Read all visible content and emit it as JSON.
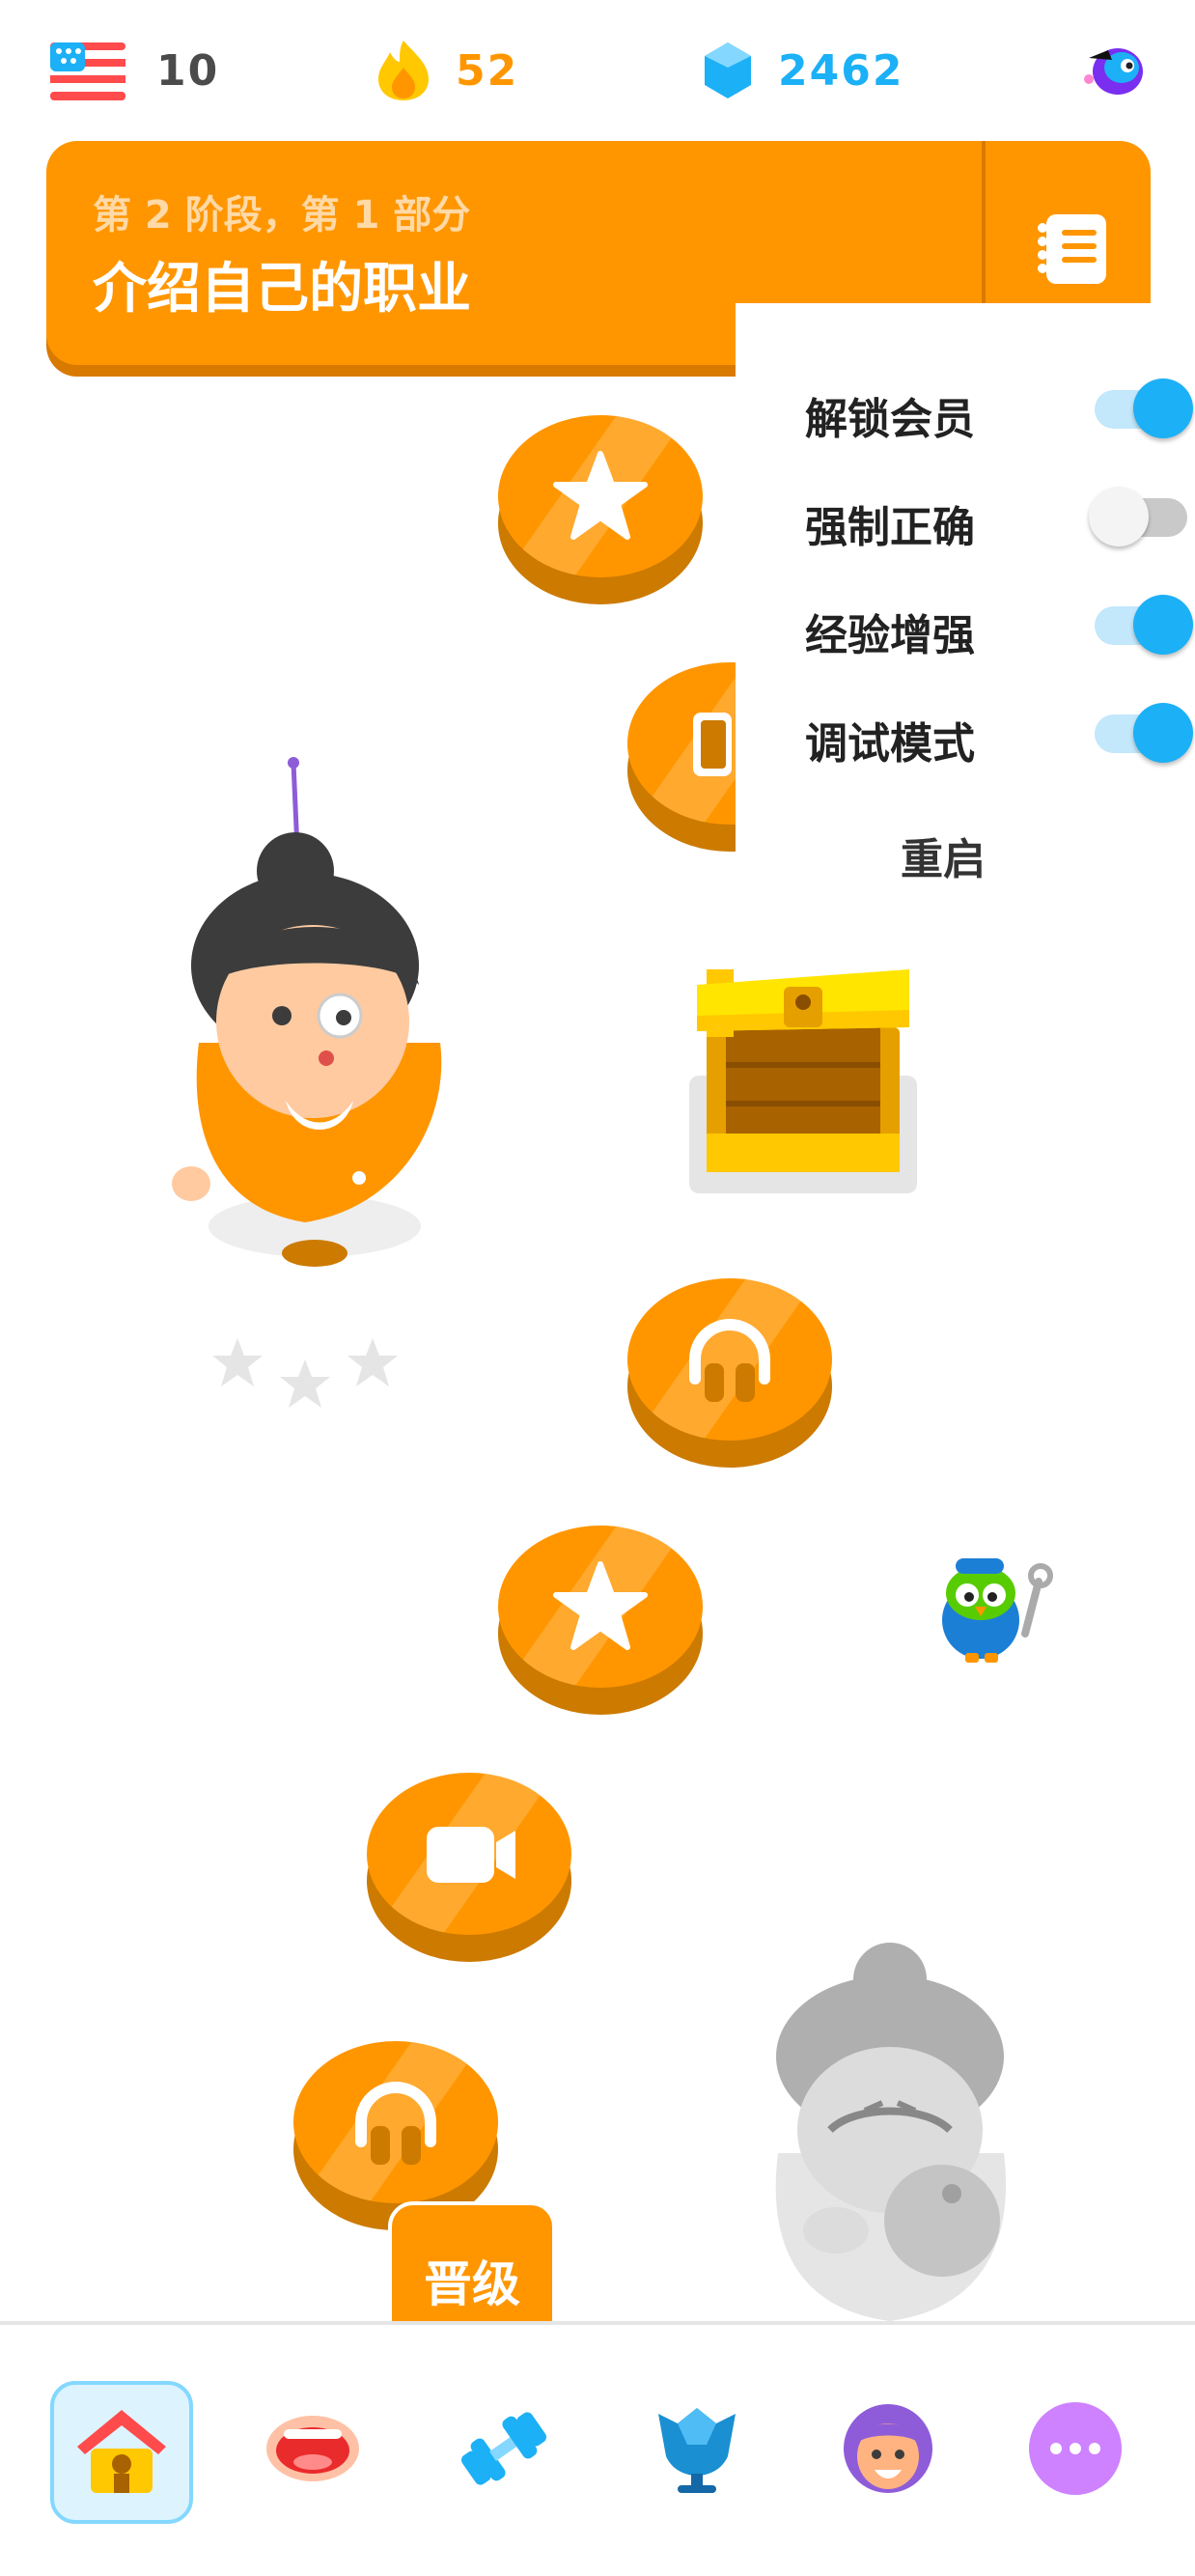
{
  "stats": {
    "course_flag": "us-flag-icon",
    "course_count": "10",
    "streak_icon": "fire-icon",
    "streak": "52",
    "gems_icon": "gem-icon",
    "gems": "2462",
    "profile_icon": "duo-avatar-icon",
    "colors": {
      "count": "#4b4b4b",
      "streak": "#ff9600",
      "gems": "#1cb0f6"
    }
  },
  "unit": {
    "subtitle": "第 2 阶段，第 1 部分",
    "title": "介绍自己的职业",
    "guide_icon": "guidebook-icon",
    "color": "#ff9600"
  },
  "debug_panel": {
    "toggles": [
      {
        "label": "解锁会员",
        "on": true
      },
      {
        "label": "强制正确",
        "on": false
      },
      {
        "label": "经验增强",
        "on": true
      },
      {
        "label": "调试模式",
        "on": true
      }
    ],
    "restart_label": "重启"
  },
  "path": {
    "nodes": [
      {
        "type": "star-icon"
      },
      {
        "type": "book-icon"
      },
      {
        "type": "treasure-chest-icon"
      },
      {
        "type": "headphones-icon"
      },
      {
        "type": "star-icon"
      },
      {
        "type": "video-icon"
      },
      {
        "type": "headphones-icon"
      }
    ],
    "promote_label": "晋级"
  },
  "nav": {
    "items": [
      {
        "name": "home",
        "active": true
      },
      {
        "name": "speak",
        "active": false
      },
      {
        "name": "practice",
        "active": false
      },
      {
        "name": "leaderboard",
        "active": false
      },
      {
        "name": "characters",
        "active": false
      },
      {
        "name": "more",
        "active": false
      }
    ]
  }
}
